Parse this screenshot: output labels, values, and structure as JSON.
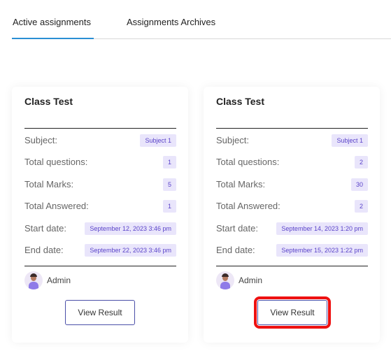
{
  "tabs": [
    {
      "label": "Active assignments",
      "active": true
    },
    {
      "label": "Assignments Archives",
      "active": false
    }
  ],
  "accent_color": "#2a8fd4",
  "badge_color": "#e9e5fb",
  "highlight_color": "#ee1111",
  "field_labels": {
    "subject": "Subject:",
    "total_questions": "Total questions:",
    "total_marks": "Total Marks:",
    "total_answered": "Total Answered:",
    "start_date": "Start date:",
    "end_date": "End date:"
  },
  "cards": [
    {
      "title": "Class Test",
      "subject": "Subject 1",
      "total_questions": "1",
      "total_marks": "5",
      "total_answered": "1",
      "start_date": "September 12, 2023 3:46 pm",
      "end_date": "September 22, 2023 3:46 pm",
      "author": "Admin",
      "button_label": "View Result",
      "highlighted": false
    },
    {
      "title": "Class Test",
      "subject": "Subject 1",
      "total_questions": "2",
      "total_marks": "30",
      "total_answered": "2",
      "start_date": "September 14, 2023 1:20 pm",
      "end_date": "September 15, 2023 1:22 pm",
      "author": "Admin",
      "button_label": "View Result",
      "highlighted": true
    }
  ]
}
